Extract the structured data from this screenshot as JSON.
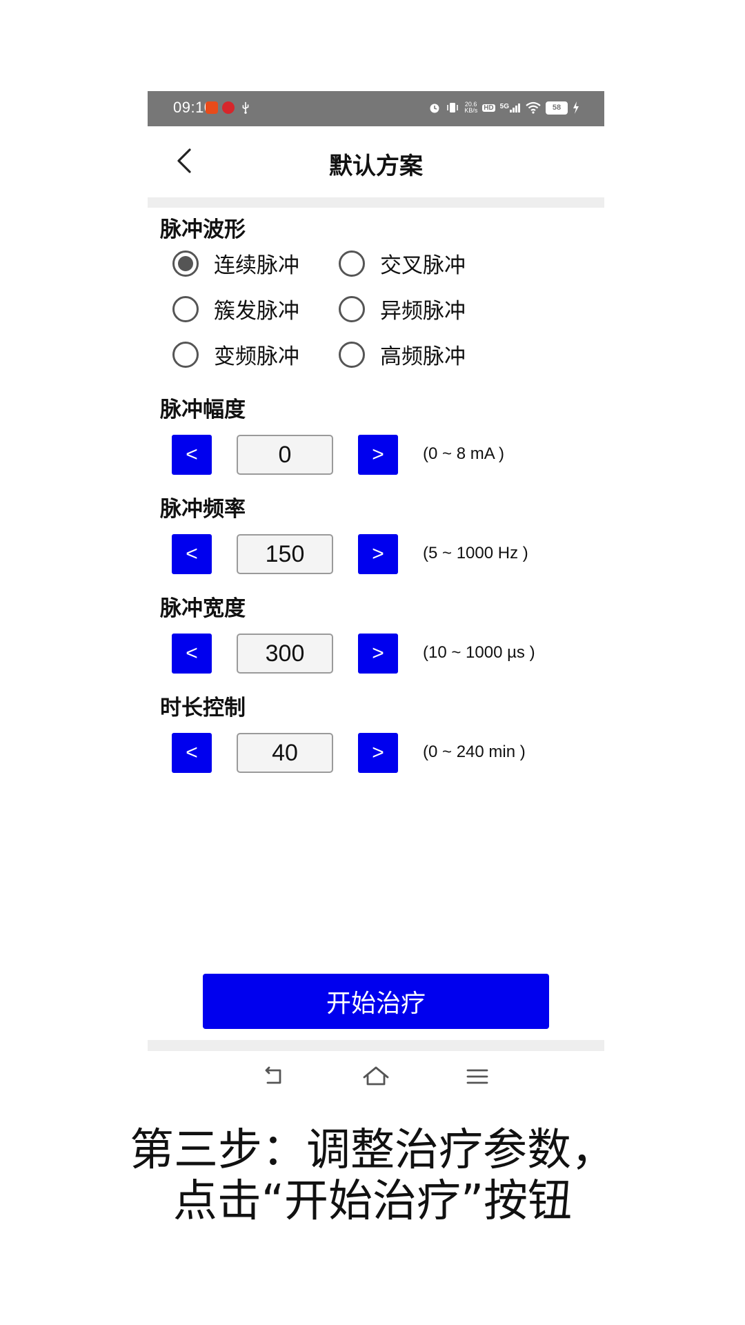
{
  "status_bar": {
    "time": "09:10",
    "net_speed_value": "20.6",
    "net_speed_unit": "KB/s",
    "hd_label": "HD",
    "signal_label": "5G",
    "battery_level": "58"
  },
  "header": {
    "title": "默认方案",
    "back_icon": "chevron-left-icon"
  },
  "waveform": {
    "label": "脉冲波形",
    "options": [
      {
        "label": "连续脉冲",
        "selected": true
      },
      {
        "label": "交叉脉冲",
        "selected": false
      },
      {
        "label": "簇发脉冲",
        "selected": false
      },
      {
        "label": "异频脉冲",
        "selected": false
      },
      {
        "label": "变频脉冲",
        "selected": false
      },
      {
        "label": "高频脉冲",
        "selected": false
      }
    ]
  },
  "controls": [
    {
      "label": "脉冲幅度",
      "decrement": "<",
      "value": "0",
      "increment": ">",
      "range": "(0 ~ 8 mA )"
    },
    {
      "label": "脉冲频率",
      "decrement": "<",
      "value": "150",
      "increment": ">",
      "range": "(5 ~ 1000 Hz )"
    },
    {
      "label": "脉冲宽度",
      "decrement": "<",
      "value": "300",
      "increment": ">",
      "range": "(10 ~ 1000 µs )"
    },
    {
      "label": "时长控制",
      "decrement": "<",
      "value": "40",
      "increment": ">",
      "range": "(0 ~ 240 min )"
    }
  ],
  "start_button": {
    "label": "开始治疗"
  },
  "nav": [
    "back-icon",
    "home-icon",
    "menu-icon"
  ],
  "caption": {
    "line1": "第三步：调整治疗参数，",
    "line2": "点击“开始治疗”按钮"
  },
  "colors": {
    "accent": "#0000ee",
    "status_bar": "#777777",
    "divider": "#eeeeee"
  }
}
